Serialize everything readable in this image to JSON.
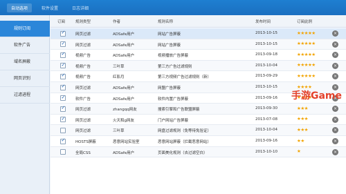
{
  "tabs": [
    {
      "label": "自动选项",
      "active": true
    },
    {
      "label": "软件设置",
      "active": false
    },
    {
      "label": "日志详细",
      "active": false
    }
  ],
  "sidebar": [
    {
      "label": "规则订阅",
      "active": true
    },
    {
      "label": "软件广告",
      "active": false
    },
    {
      "label": "域名屏蔽",
      "active": false
    },
    {
      "label": "网页识别",
      "active": false
    },
    {
      "label": "过滤进程",
      "active": false
    }
  ],
  "columns": [
    "订阅",
    "规则类型",
    "作者",
    "规则名称",
    "发布时间",
    "订阅此例"
  ],
  "rows": [
    {
      "checked": true,
      "type": "网页过滤",
      "author": "ADSafe用户",
      "name": "网站广告屏蔽",
      "date": "2013-10-15",
      "stars": "★★★★★"
    },
    {
      "checked": true,
      "type": "网页过滤",
      "author": "ADSafe用户",
      "name": "网站广告屏蔽",
      "date": "2013-10-15",
      "stars": "★★★★★"
    },
    {
      "checked": true,
      "type": "视频广告",
      "author": "ADSafe用户",
      "name": "视频播放广告屏蔽",
      "date": "2013-09-18",
      "stars": "★★★★★"
    },
    {
      "checked": true,
      "type": "视频广告",
      "author": "三叶草",
      "name": "第三方广告过滤规则",
      "date": "2013-10-04",
      "stars": "★★★★★"
    },
    {
      "checked": true,
      "type": "视频广告",
      "author": "红影月",
      "name": "第三方视频广告过滤规则（新）",
      "date": "2013-09-29",
      "stars": "★★★★★"
    },
    {
      "checked": true,
      "type": "网页过滤",
      "author": "ADSafe用户",
      "name": "网盟广告屏蔽",
      "date": "2013-10-15",
      "stars": "★★★★"
    },
    {
      "checked": true,
      "type": "软件广告",
      "author": "ADSafe用户",
      "name": "软件内置广告屏蔽",
      "date": "2013-09-16",
      "stars": "★★★★"
    },
    {
      "checked": true,
      "type": "网页过滤",
      "author": "zhangqq网友",
      "name": "搜索引擎和广告联盟屏蔽",
      "date": "2013-09-30",
      "stars": "★★★"
    },
    {
      "checked": true,
      "type": "网页过滤",
      "author": "火天和g网友",
      "name": "门户网站广告屏蔽",
      "date": "2013-07-08",
      "stars": "★★★"
    },
    {
      "checked": false,
      "type": "网页过滤",
      "author": "三叶草",
      "name": "网盘过滤规则（免等待免验证）",
      "date": "2013-10-04",
      "stars": "★★★"
    },
    {
      "checked": true,
      "type": "HOSTS屏蔽",
      "author": "恶意网站实验室",
      "name": "恶意网站屏蔽（拦截恶意网站）",
      "date": "2013-09-16",
      "stars": "★★"
    },
    {
      "checked": false,
      "type": "全局CSS",
      "author": "ADSafe用户",
      "name": "页面美化规则（去过滤空白）",
      "date": "2013-10-10",
      "stars": "★"
    }
  ],
  "watermark": {
    "text": "手游Game"
  },
  "icons": {
    "delete": "close-circle-icon"
  }
}
